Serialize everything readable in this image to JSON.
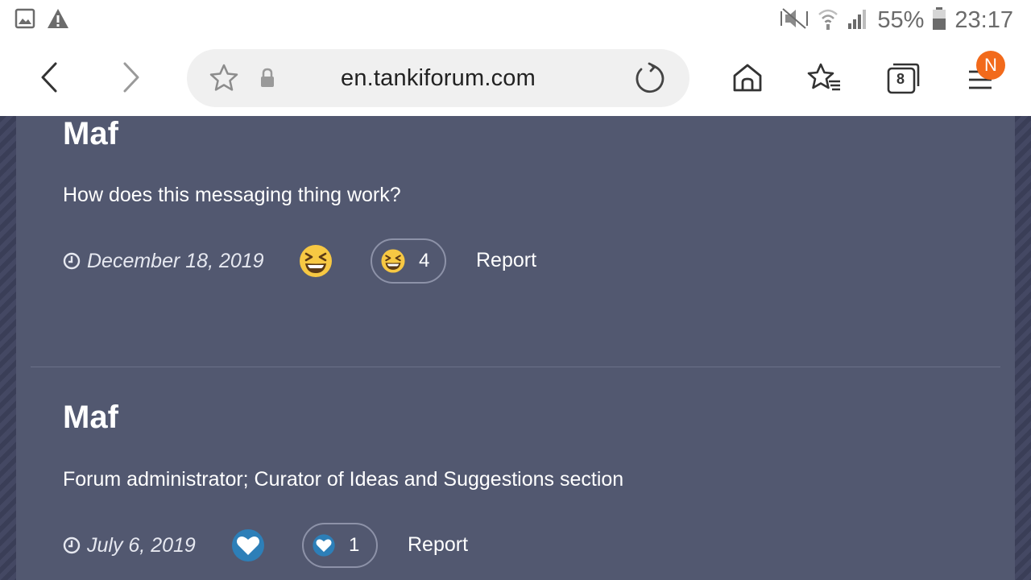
{
  "status_bar": {
    "battery_percent": "55%",
    "time": "23:17",
    "icons": [
      "gallery-icon",
      "warning-icon",
      "mute-icon",
      "wifi-icon",
      "signal-icon",
      "battery-icon"
    ]
  },
  "browser": {
    "url": "en.tankiforum.com",
    "tab_count": "8",
    "notification_badge": "N",
    "accent_color": "#f26a1b"
  },
  "posts": [
    {
      "author": "Maf",
      "message": "How does this messaging thing work?",
      "date": "December 18, 2019",
      "reaction_icon": "laughing-emoji-icon",
      "reaction_count": "4",
      "report_label": "Report"
    },
    {
      "author": "Maf",
      "message": "Forum administrator; Curator of Ideas and Suggestions section",
      "date": "July 6, 2019",
      "reaction_icon": "heart-icon",
      "reaction_count": "1",
      "report_label": "Report"
    }
  ],
  "colors": {
    "page_background": "#3c4059",
    "card_background": "#525870",
    "text": "#ffffff",
    "heart_blue": "#2d7fb8",
    "emoji_yellow": "#f7c843"
  }
}
